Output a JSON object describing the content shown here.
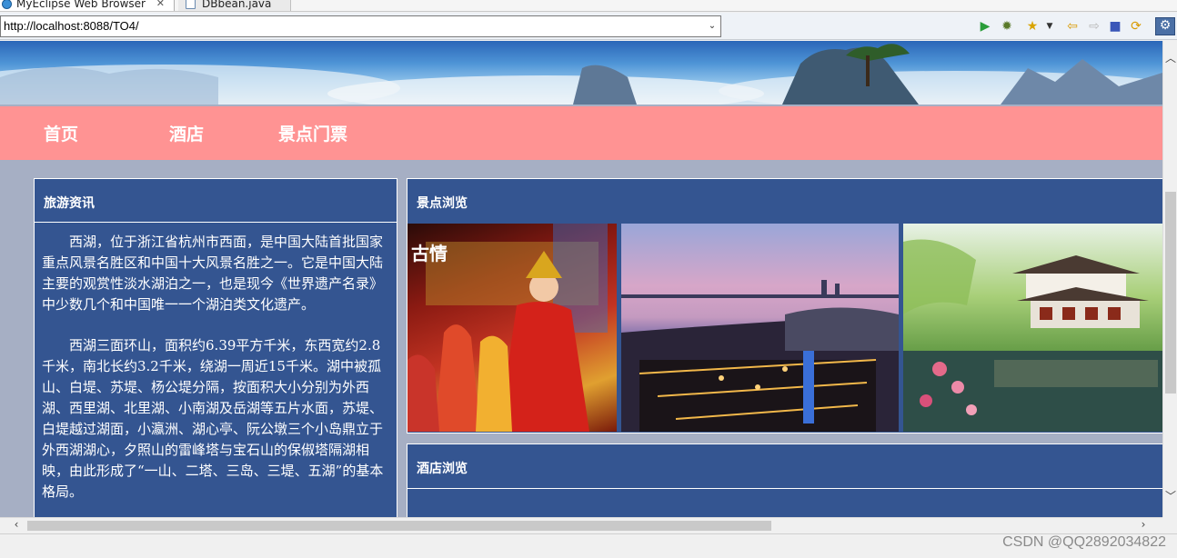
{
  "tabs": [
    {
      "label": "MyEclipse Web Browser",
      "icon": "globe-icon",
      "active": true
    },
    {
      "label": "DBbean.java",
      "icon": "java-file-icon",
      "active": false
    }
  ],
  "toolbar": {
    "url": "http://localhost:8088/TO4/",
    "buttons": [
      "run-icon",
      "debug-icon",
      "favorite-icon",
      "dropdown-icon",
      "back-icon",
      "forward-icon",
      "stop-icon",
      "refresh-icon",
      "perspective-icon"
    ]
  },
  "nav": {
    "items": [
      "首页",
      "酒店",
      "景点门票"
    ]
  },
  "news": {
    "title": "旅游资讯",
    "paragraphs": [
      "西湖，位于浙江省杭州市西面，是中国大陆首批国家重点风景名胜区和中国十大风景名胜之一。它是中国大陆主要的观赏性淡水湖泊之一，也是现今《世界遗产名录》中少数几个和中国唯一一个湖泊类文化遗产。",
      "西湖三面环山，面积约6.39平方千米，东西宽约2.8千米，南北长约3.2千米，绕湖一周近15千米。湖中被孤山、白堤、苏堤、杨公堤分隔，按面积大小分别为外西湖、西里湖、北里湖、小南湖及岳湖等五片水面，苏堤、白堤越过湖面，小瀛洲、湖心亭、阮公墩三个小岛鼎立于外西湖湖心，夕照山的雷峰塔与宝石山的保俶塔隔湖相映，由此形成了“一山、二塔、三岛、三堤、五湖”的基本格局。"
    ]
  },
  "scenic": {
    "title": "景点浏览",
    "photo_overlay_text": "古情"
  },
  "hotel": {
    "title": "酒店浏览"
  },
  "watermark": "CSDN @QQ2892034822",
  "colors": {
    "nav_bg": "#ff9393",
    "panel_bg": "#345591",
    "page_bg": "#a6afc4"
  }
}
